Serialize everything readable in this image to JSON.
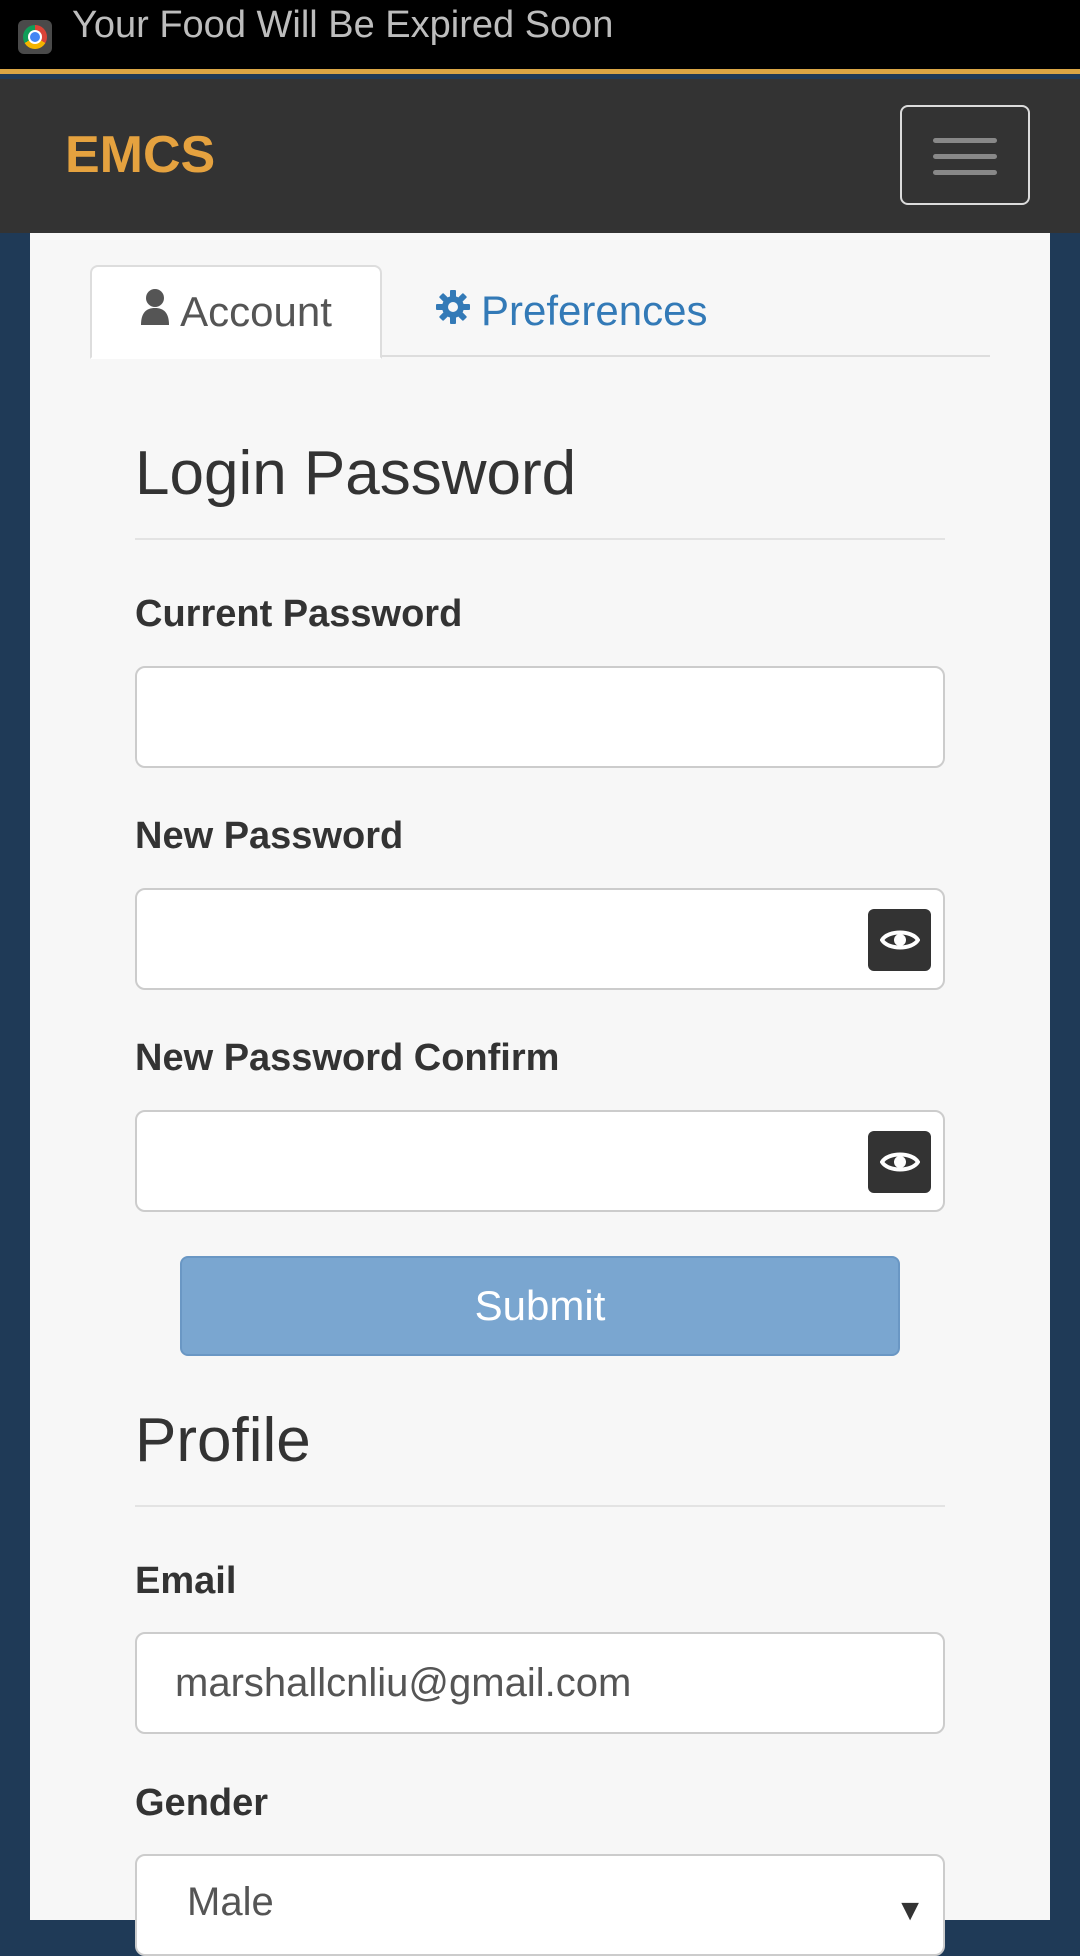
{
  "status_bar": {
    "notification_text": "Your Food Will Be Expired Soon",
    "app_icon": "chrome-icon"
  },
  "navbar": {
    "brand": "EMCS",
    "menu_icon": "hamburger-menu-icon",
    "brand_color": "#e5a23f"
  },
  "tabs": [
    {
      "label": "Account",
      "icon": "user-icon",
      "active": true
    },
    {
      "label": "Preferences",
      "icon": "gear-icon",
      "active": false
    }
  ],
  "login_section": {
    "title": "Login Password",
    "current_password": {
      "label": "Current Password",
      "value": ""
    },
    "new_password": {
      "label": "New Password",
      "value": "",
      "toggle_icon": "eye-icon"
    },
    "new_password_confirm": {
      "label": "New Password Confirm",
      "value": "",
      "toggle_icon": "eye-icon"
    },
    "submit_label": "Submit"
  },
  "profile_section": {
    "title": "Profile",
    "email": {
      "label": "Email",
      "value": "marshallcnliu@gmail.com"
    },
    "gender": {
      "label": "Gender",
      "value": "Male"
    }
  },
  "colors": {
    "link": "#337ab7",
    "submit": "#7aa6d0",
    "background": "#1f3a57"
  }
}
